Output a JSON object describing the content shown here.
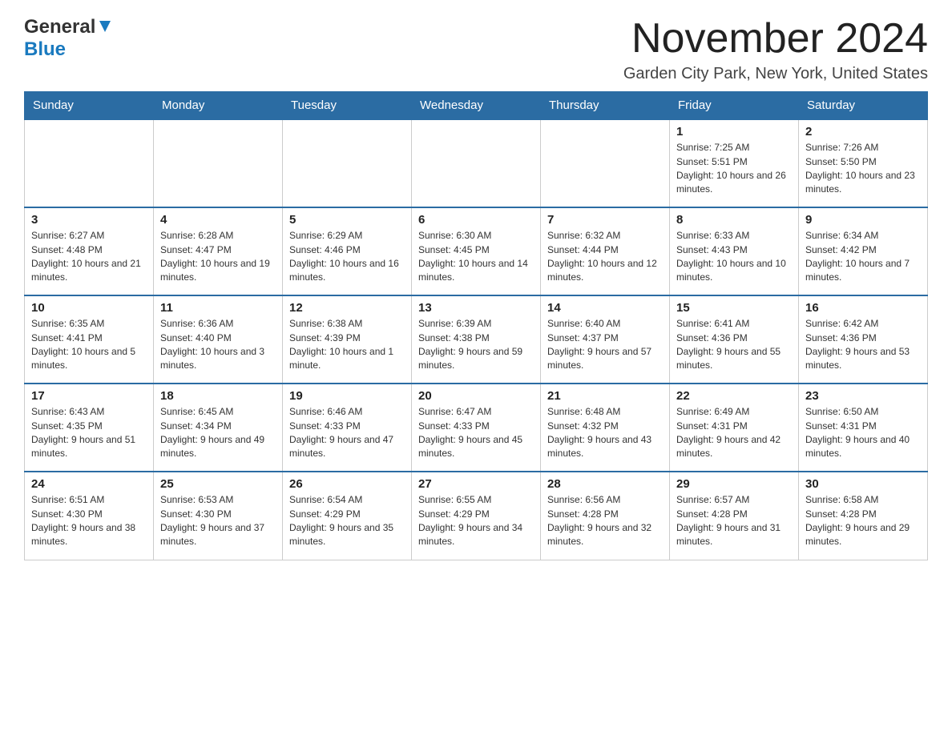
{
  "header": {
    "logo_general": "General",
    "logo_blue": "Blue",
    "month_title": "November 2024",
    "location": "Garden City Park, New York, United States"
  },
  "weekdays": [
    "Sunday",
    "Monday",
    "Tuesday",
    "Wednesday",
    "Thursday",
    "Friday",
    "Saturday"
  ],
  "weeks": [
    [
      {
        "day": "",
        "sunrise": "",
        "sunset": "",
        "daylight": ""
      },
      {
        "day": "",
        "sunrise": "",
        "sunset": "",
        "daylight": ""
      },
      {
        "day": "",
        "sunrise": "",
        "sunset": "",
        "daylight": ""
      },
      {
        "day": "",
        "sunrise": "",
        "sunset": "",
        "daylight": ""
      },
      {
        "day": "",
        "sunrise": "",
        "sunset": "",
        "daylight": ""
      },
      {
        "day": "1",
        "sunrise": "Sunrise: 7:25 AM",
        "sunset": "Sunset: 5:51 PM",
        "daylight": "Daylight: 10 hours and 26 minutes."
      },
      {
        "day": "2",
        "sunrise": "Sunrise: 7:26 AM",
        "sunset": "Sunset: 5:50 PM",
        "daylight": "Daylight: 10 hours and 23 minutes."
      }
    ],
    [
      {
        "day": "3",
        "sunrise": "Sunrise: 6:27 AM",
        "sunset": "Sunset: 4:48 PM",
        "daylight": "Daylight: 10 hours and 21 minutes."
      },
      {
        "day": "4",
        "sunrise": "Sunrise: 6:28 AM",
        "sunset": "Sunset: 4:47 PM",
        "daylight": "Daylight: 10 hours and 19 minutes."
      },
      {
        "day": "5",
        "sunrise": "Sunrise: 6:29 AM",
        "sunset": "Sunset: 4:46 PM",
        "daylight": "Daylight: 10 hours and 16 minutes."
      },
      {
        "day": "6",
        "sunrise": "Sunrise: 6:30 AM",
        "sunset": "Sunset: 4:45 PM",
        "daylight": "Daylight: 10 hours and 14 minutes."
      },
      {
        "day": "7",
        "sunrise": "Sunrise: 6:32 AM",
        "sunset": "Sunset: 4:44 PM",
        "daylight": "Daylight: 10 hours and 12 minutes."
      },
      {
        "day": "8",
        "sunrise": "Sunrise: 6:33 AM",
        "sunset": "Sunset: 4:43 PM",
        "daylight": "Daylight: 10 hours and 10 minutes."
      },
      {
        "day": "9",
        "sunrise": "Sunrise: 6:34 AM",
        "sunset": "Sunset: 4:42 PM",
        "daylight": "Daylight: 10 hours and 7 minutes."
      }
    ],
    [
      {
        "day": "10",
        "sunrise": "Sunrise: 6:35 AM",
        "sunset": "Sunset: 4:41 PM",
        "daylight": "Daylight: 10 hours and 5 minutes."
      },
      {
        "day": "11",
        "sunrise": "Sunrise: 6:36 AM",
        "sunset": "Sunset: 4:40 PM",
        "daylight": "Daylight: 10 hours and 3 minutes."
      },
      {
        "day": "12",
        "sunrise": "Sunrise: 6:38 AM",
        "sunset": "Sunset: 4:39 PM",
        "daylight": "Daylight: 10 hours and 1 minute."
      },
      {
        "day": "13",
        "sunrise": "Sunrise: 6:39 AM",
        "sunset": "Sunset: 4:38 PM",
        "daylight": "Daylight: 9 hours and 59 minutes."
      },
      {
        "day": "14",
        "sunrise": "Sunrise: 6:40 AM",
        "sunset": "Sunset: 4:37 PM",
        "daylight": "Daylight: 9 hours and 57 minutes."
      },
      {
        "day": "15",
        "sunrise": "Sunrise: 6:41 AM",
        "sunset": "Sunset: 4:36 PM",
        "daylight": "Daylight: 9 hours and 55 minutes."
      },
      {
        "day": "16",
        "sunrise": "Sunrise: 6:42 AM",
        "sunset": "Sunset: 4:36 PM",
        "daylight": "Daylight: 9 hours and 53 minutes."
      }
    ],
    [
      {
        "day": "17",
        "sunrise": "Sunrise: 6:43 AM",
        "sunset": "Sunset: 4:35 PM",
        "daylight": "Daylight: 9 hours and 51 minutes."
      },
      {
        "day": "18",
        "sunrise": "Sunrise: 6:45 AM",
        "sunset": "Sunset: 4:34 PM",
        "daylight": "Daylight: 9 hours and 49 minutes."
      },
      {
        "day": "19",
        "sunrise": "Sunrise: 6:46 AM",
        "sunset": "Sunset: 4:33 PM",
        "daylight": "Daylight: 9 hours and 47 minutes."
      },
      {
        "day": "20",
        "sunrise": "Sunrise: 6:47 AM",
        "sunset": "Sunset: 4:33 PM",
        "daylight": "Daylight: 9 hours and 45 minutes."
      },
      {
        "day": "21",
        "sunrise": "Sunrise: 6:48 AM",
        "sunset": "Sunset: 4:32 PM",
        "daylight": "Daylight: 9 hours and 43 minutes."
      },
      {
        "day": "22",
        "sunrise": "Sunrise: 6:49 AM",
        "sunset": "Sunset: 4:31 PM",
        "daylight": "Daylight: 9 hours and 42 minutes."
      },
      {
        "day": "23",
        "sunrise": "Sunrise: 6:50 AM",
        "sunset": "Sunset: 4:31 PM",
        "daylight": "Daylight: 9 hours and 40 minutes."
      }
    ],
    [
      {
        "day": "24",
        "sunrise": "Sunrise: 6:51 AM",
        "sunset": "Sunset: 4:30 PM",
        "daylight": "Daylight: 9 hours and 38 minutes."
      },
      {
        "day": "25",
        "sunrise": "Sunrise: 6:53 AM",
        "sunset": "Sunset: 4:30 PM",
        "daylight": "Daylight: 9 hours and 37 minutes."
      },
      {
        "day": "26",
        "sunrise": "Sunrise: 6:54 AM",
        "sunset": "Sunset: 4:29 PM",
        "daylight": "Daylight: 9 hours and 35 minutes."
      },
      {
        "day": "27",
        "sunrise": "Sunrise: 6:55 AM",
        "sunset": "Sunset: 4:29 PM",
        "daylight": "Daylight: 9 hours and 34 minutes."
      },
      {
        "day": "28",
        "sunrise": "Sunrise: 6:56 AM",
        "sunset": "Sunset: 4:28 PM",
        "daylight": "Daylight: 9 hours and 32 minutes."
      },
      {
        "day": "29",
        "sunrise": "Sunrise: 6:57 AM",
        "sunset": "Sunset: 4:28 PM",
        "daylight": "Daylight: 9 hours and 31 minutes."
      },
      {
        "day": "30",
        "sunrise": "Sunrise: 6:58 AM",
        "sunset": "Sunset: 4:28 PM",
        "daylight": "Daylight: 9 hours and 29 minutes."
      }
    ]
  ]
}
